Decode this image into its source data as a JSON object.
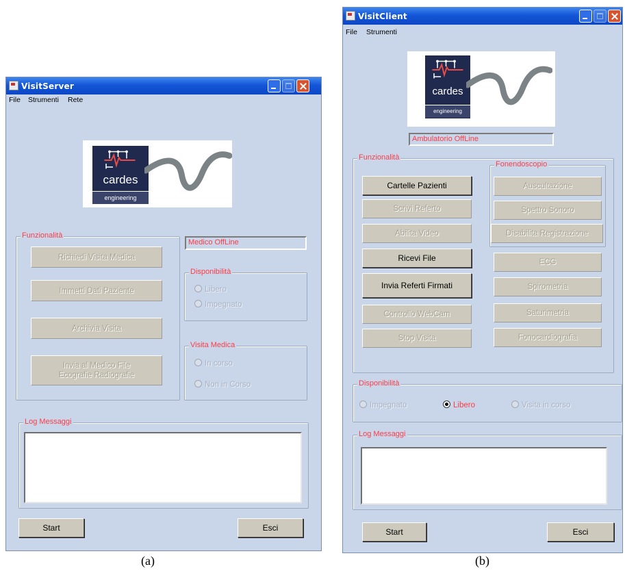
{
  "server": {
    "title": "VisitServer",
    "menu": [
      "File",
      "Strumenti",
      "Rete"
    ],
    "logo": {
      "word": "cardes",
      "tagline": "engineering"
    },
    "funzionalita_label": "Funzionalità",
    "buttons": {
      "richiedi": "Richiedi Visita Medica",
      "immetti": "Immetti Dati Paziente",
      "archivia": "Archivia Visita",
      "invia_line1": "Invia al Medico File",
      "invia_line2": "Ecografie Radiografie"
    },
    "status": "Medico OffLine",
    "disponibilita": {
      "label": "Disponibilità",
      "libero": "Libero",
      "impegnato": "Impegnato"
    },
    "visita": {
      "label": "Visita Medica",
      "in_corso": "In corso",
      "non_in_corso": "Non in Corso"
    },
    "log_label": "Log Messaggi",
    "start": "Start",
    "esci": "Esci",
    "caption": "(a)"
  },
  "client": {
    "title": "VisitClient",
    "menu": [
      "File",
      "Strumenti"
    ],
    "logo": {
      "word": "cardes",
      "tagline": "engineering"
    },
    "status": "Ambulatorio OffLine",
    "funzionalita_label": "Funzionalità",
    "buttons": {
      "cartelle": "Cartelle Pazienti",
      "scrivi": "Scrivi Referto",
      "abilita": "Abilita Video",
      "ricevi": "Ricevi File",
      "invia": "Invia Referti Firmati",
      "controllo": "Controllo WebCam",
      "stop": "Stop Visita"
    },
    "fonendoscopio": {
      "label": "Fonendoscopio",
      "auscultazione": "Auscultazione",
      "spettro": "Spettro Sonoro",
      "disabilita": "Disabilita Registrazione",
      "ecg": "ECG",
      "spirometria": "Spirometria",
      "saturimetria": "Saturimetria",
      "fonocardiografia": "Fonocardiografia"
    },
    "disponibilita": {
      "label": "Disponibilità",
      "impegnato": "Impegnato",
      "libero": "Libero",
      "visita": "Visita in corso"
    },
    "log_label": "Log Messaggi",
    "start": "Start",
    "esci": "Esci",
    "caption": "(b)"
  },
  "colors": {
    "window_bg": "#c9d6e9",
    "titlebar": "#1456d8",
    "accent_red": "#ff3b45",
    "button_face": "#cdcabd"
  }
}
